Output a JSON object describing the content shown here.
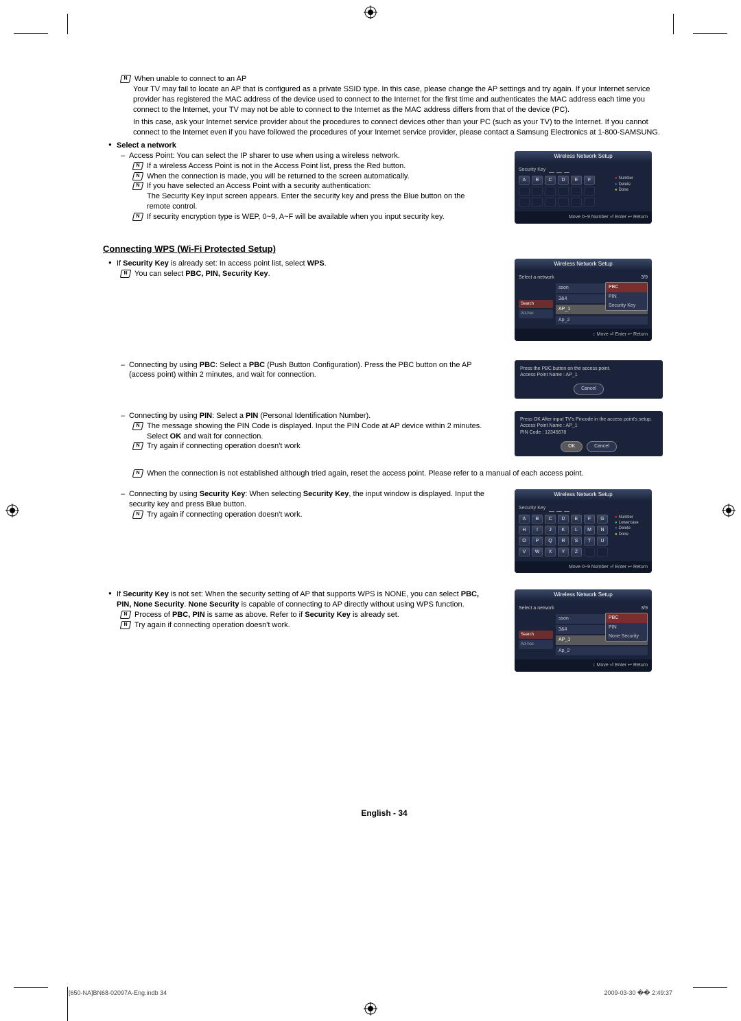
{
  "doc": {
    "note_unable": "When unable to connect to an AP",
    "para_private_ssid": "Your TV may fail to locate an AP that is configured as a private SSID type. In this case, please change the AP settings and try again. If your Internet service provider has registered the MAC address of the device used to connect to the Internet for the first time and authenticates the MAC address each time you connect to the Internet, your TV may not be able to connect to the Internet as the MAC address differs from that of the device (PC).",
    "para_isp_contact": "In this case, ask your Internet service provider about the procedures to connect devices other than your PC (such as your TV) to the Internet. If you cannot connect to the Internet even if you have followed the procedures of your Internet service provider, please contact a Samsung Electronics at 1-800-SAMSUNG.",
    "select_network": "Select a network",
    "access_point_line": "Access Point: You can select the IP sharer to use when using a wireless network.",
    "note_red_button": "If a wireless Access Point is not in the Access Point list, press the Red button.",
    "note_auto_return": "When the connection is made, you will be returned to the screen automatically.",
    "note_sec_auth": "If you have selected an Access Point with a security authentication:",
    "sec_key_para": "The Security Key input screen appears. Enter the security key and press the Blue button on the remote control.",
    "note_wep": "If security encryption type is WEP, 0~9, A~F will be available when you input security key.",
    "section_wps": "Connecting WPS (Wi-Fi Protected Setup)",
    "wps_set_bold1": "Security Key",
    "wps_set_text1": " is already set: In access point list, select ",
    "wps_set_bold2": "WPS",
    "wps_note_select_pre": "You can select ",
    "wps_note_select_bold": "PBC, PIN, Security Key",
    "pbc_pre": "Connecting by using ",
    "pbc_bold1": "PBC",
    "pbc_mid": ": Select a ",
    "pbc_bold2": "PBC",
    "pbc_post": " (Push Button Configuration). Press the PBC button on the AP (access point) within 2 minutes, and wait for connection.",
    "pin_pre": "Connecting by using ",
    "pin_bold1": "PIN",
    "pin_mid": ": Select a ",
    "pin_bold2": "PIN",
    "pin_post": " (Personal Identification Number).",
    "pin_note1_pre": "The message showing the PIN Code is displayed. Input the PIN Code at AP device within 2 minutes. Select ",
    "pin_note1_bold": "OK",
    "pin_note1_post": " and wait for connection.",
    "try_again": "Try again if connecting operation doesn't work",
    "try_again_period": "Try again if connecting operation doesn't work.",
    "reset_note": "When the connection is not established although tried again, reset the access point. Please refer to a manual of each access point.",
    "seckey_line_pre": "Connecting by using ",
    "seckey_bold1": "Security Key",
    "seckey_line_mid": ": When selecting ",
    "seckey_bold2": "Security Key",
    "seckey_line_post": ", the input window is displayed. Input the security key and press Blue button.",
    "notset_pre": "If ",
    "notset_bold1": "Security Key",
    "notset_mid": " is not set: When the security setting of AP that supports WPS is NONE, you can select ",
    "notset_bold2": "PBC, PIN, None Security",
    "notset_mid2": ". ",
    "notset_bold3": "None Security",
    "notset_post": " is capable of connecting to AP directly without using WPS function.",
    "process_pre": "Process of ",
    "process_bold": "PBC, PIN",
    "process_mid": " is same as above. Refer to if ",
    "process_bold2": "Security Key",
    "process_post": " is already set.",
    "page_footer": "English - 34",
    "print_left": "[650-NA]BN68-02097A-Eng.indb   34",
    "print_right": "2009-03-30   �� 2:49:37"
  },
  "ui1": {
    "title": "Wireless Network Setup",
    "seclabel": "Security Key",
    "num": "Number",
    "del": "Delete",
    "done": "Done",
    "footer": "Move    0~9 Number    ⏎ Enter   ↩ Return",
    "keys": [
      "A",
      "B",
      "C",
      "D",
      "E",
      "F"
    ]
  },
  "ui2": {
    "title": "Wireless Network Setup",
    "left_label": "Select a network",
    "counter": "3/9",
    "search": "Search",
    "adhoc": "Ad-hoc",
    "aps": [
      "sson",
      "3&4",
      "AP_1",
      "Ap_2"
    ],
    "popup": [
      "PBC",
      "PIN",
      "Security Key"
    ],
    "footer": "↕ Move     ⏎ Enter    ↩ Return"
  },
  "ui3": {
    "line1": "Press the PBC button on the access point.",
    "line2": "Access Point Name : AP_1",
    "cancel": "Cancel"
  },
  "ui4": {
    "line1": "Press OK After input TV's Pincode in the access point's setup.",
    "line2": "Access Point Name : AP_1",
    "line3": "PIN Code : 12345678",
    "ok": "OK",
    "cancel": "Cancel"
  },
  "ui5": {
    "title": "Wireless Network Setup",
    "seclabel": "Security Key",
    "num": "Number",
    "lower": "Lowercase",
    "del": "Delete",
    "done": "Done",
    "footer": "Move    0~9 Number    ⏎ Enter   ↩ Return",
    "rows": [
      [
        "A",
        "B",
        "C",
        "D",
        "E",
        "F",
        "G"
      ],
      [
        "H",
        "I",
        "J",
        "K",
        "L",
        "M",
        "N"
      ],
      [
        "O",
        "P",
        "Q",
        "R",
        "S",
        "T",
        "U"
      ],
      [
        "V",
        "W",
        "X",
        "Y",
        "Z",
        "",
        ""
      ]
    ]
  },
  "ui6": {
    "title": "Wireless Network Setup",
    "left_label": "Select a network",
    "counter": "3/9",
    "search": "Search",
    "adhoc": "Ad-hoc",
    "aps": [
      "sson",
      "3&4",
      "AP_1",
      "Ap_2"
    ],
    "popup": [
      "PBC",
      "PIN",
      "None Security"
    ],
    "footer": "↕ Move     ⏎ Enter    ↩ Return"
  }
}
